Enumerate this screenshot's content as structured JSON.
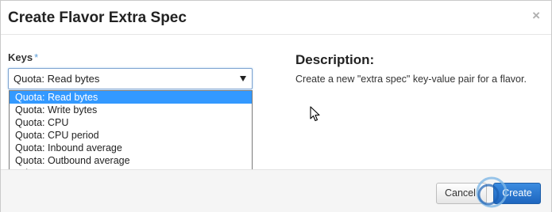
{
  "dialog": {
    "title": "Create Flavor Extra Spec",
    "close_glyph": "×"
  },
  "form": {
    "keys_label": "Keys",
    "required_marker": "*",
    "select": {
      "selected_value": "Quota: Read bytes",
      "options": [
        "Quota: Read bytes",
        "Quota: Write bytes",
        "Quota: CPU",
        "Quota: CPU period",
        "Quota: Inbound average",
        "Quota: Outbound average",
        "Other Key"
      ],
      "highlighted_index": 0
    }
  },
  "description": {
    "title": "Description:",
    "text": "Create a new \"extra spec\" key-value pair for a flavor."
  },
  "footer": {
    "cancel_label": "Cancel",
    "create_label": "Create"
  },
  "icons": {
    "close": "close-icon",
    "dropdown_arrow": "caret-down-icon",
    "cursor": "mouse-pointer-icon"
  },
  "colors": {
    "primary": "#1e66bf",
    "highlight": "#3399ff",
    "required": "#5b9bd5"
  }
}
